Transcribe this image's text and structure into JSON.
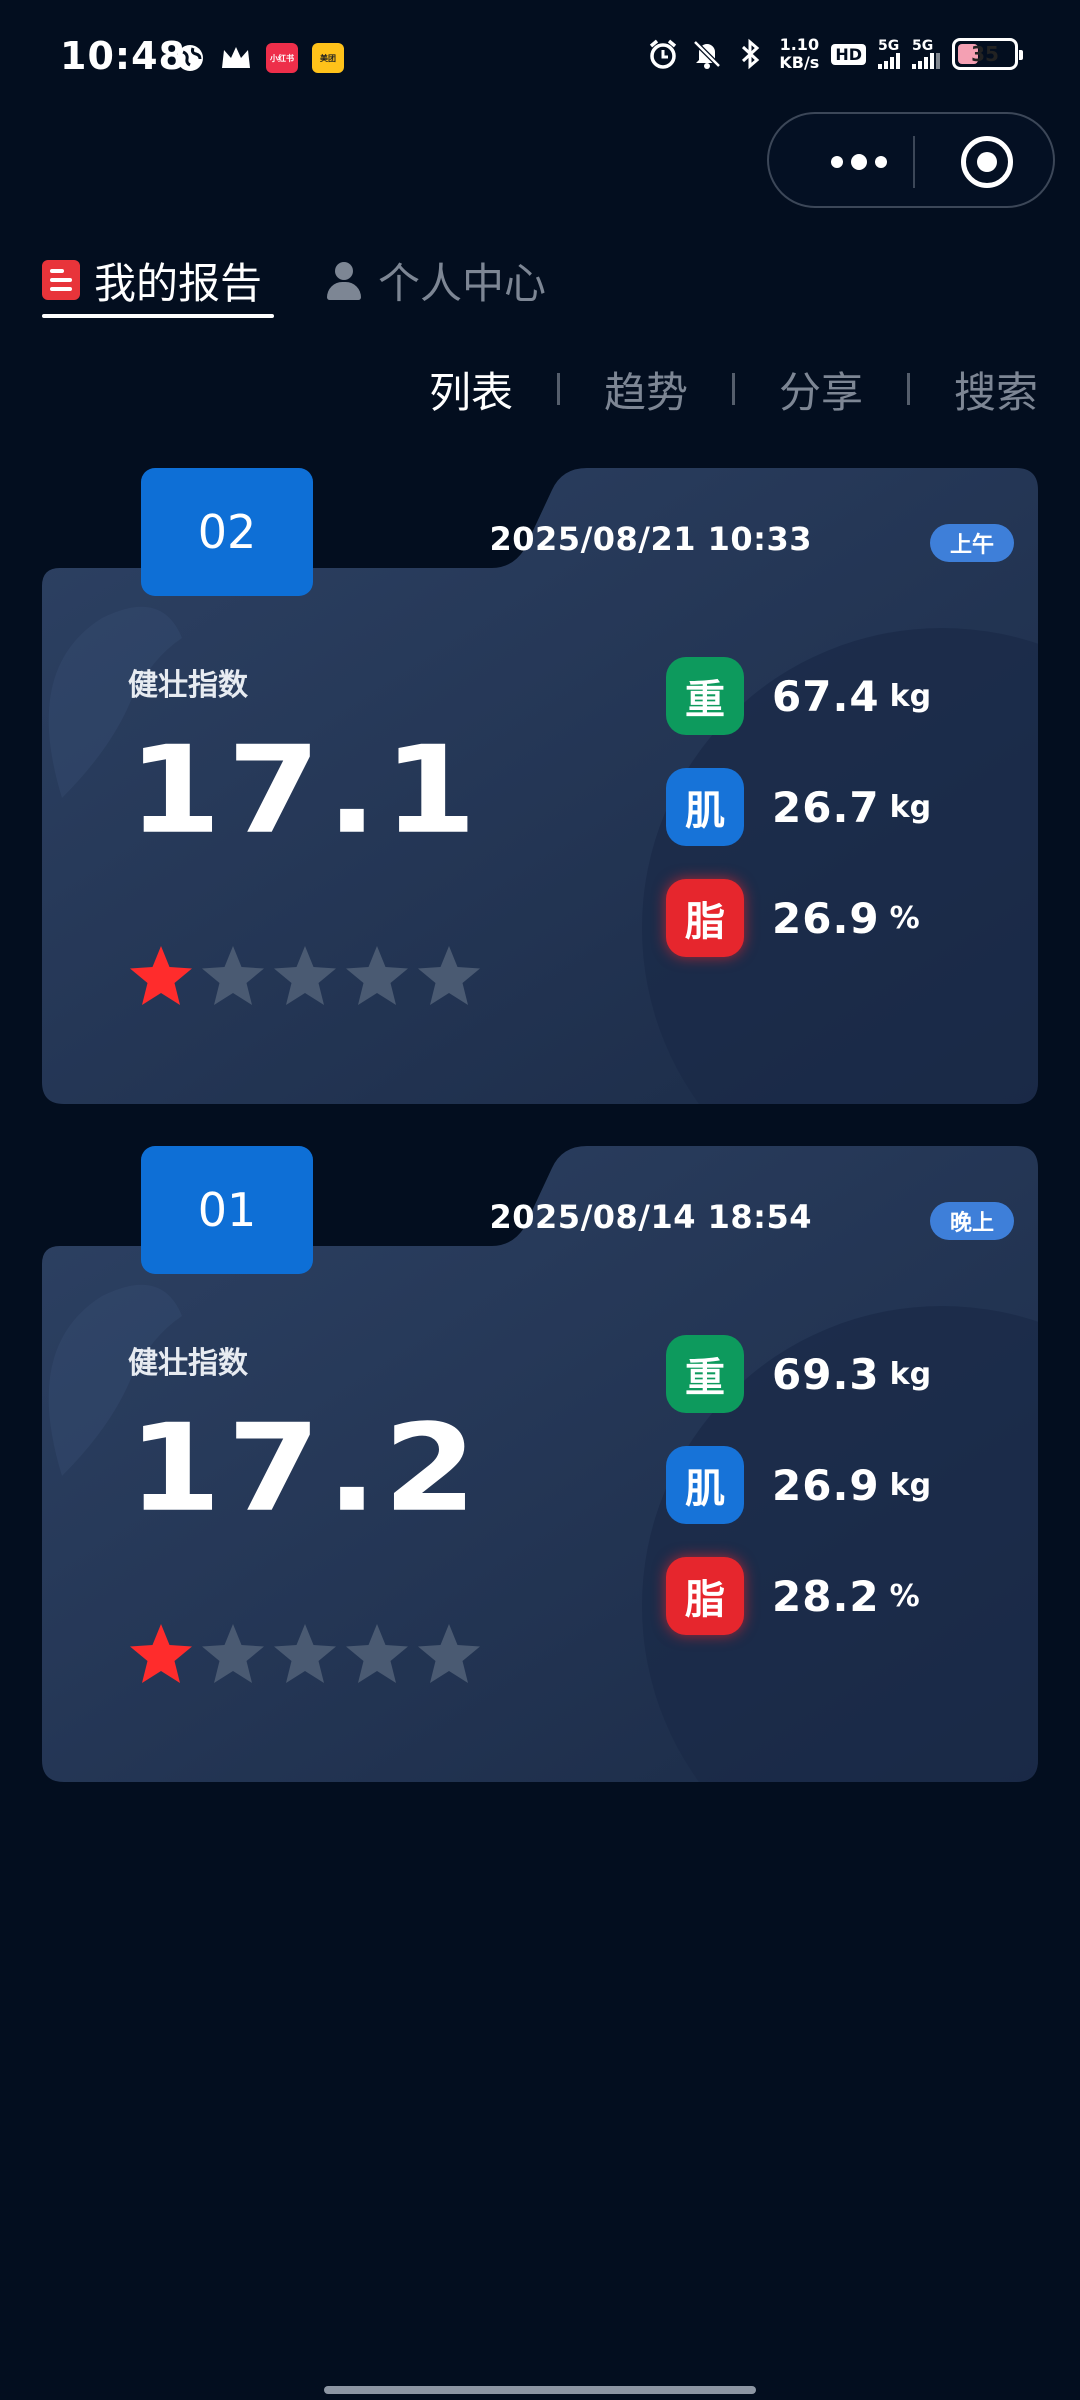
{
  "status_bar": {
    "time": "10:48",
    "app_badges": [
      "小红书",
      "美团"
    ],
    "net_speed_value": "1.10",
    "net_speed_unit": "KB/s",
    "hd_label": "HD",
    "signal_labels": [
      "5G",
      "5G"
    ],
    "battery": "35",
    "icons": [
      "globe-icon",
      "crown-icon",
      "alarm-icon",
      "mute-icon",
      "bluetooth-icon"
    ]
  },
  "capsule": {
    "icons": [
      "more-icon",
      "close-target-icon"
    ]
  },
  "tabs": [
    {
      "label": "我的报告",
      "active": true,
      "icon": "report-icon"
    },
    {
      "label": "个人中心",
      "active": false,
      "icon": "person-icon"
    }
  ],
  "subnav": [
    {
      "label": "列表",
      "active": true
    },
    {
      "label": "趋势",
      "active": false
    },
    {
      "label": "分享",
      "active": false
    },
    {
      "label": "搜索",
      "active": false
    }
  ],
  "colors": {
    "accent_blue": "#0e6fd6",
    "weight": "#0d9a5d",
    "muscle": "#1773d8",
    "fat": "#e6262d",
    "star_active": "#ff2c2c",
    "star_inactive": "#4a5a72"
  },
  "reports": [
    {
      "number": "02",
      "datetime": "2025/08/21  10:33",
      "period": "上午",
      "index_label": "健壮指数",
      "index_value": "17.1",
      "stars": 1,
      "stars_total": 5,
      "metrics": [
        {
          "icon_text": "重",
          "value": "67.4",
          "unit": "kg"
        },
        {
          "icon_text": "肌",
          "value": "26.7",
          "unit": "kg"
        },
        {
          "icon_text": "脂",
          "value": "26.9",
          "unit": "%"
        }
      ]
    },
    {
      "number": "01",
      "datetime": "2025/08/14  18:54",
      "period": "晚上",
      "index_label": "健壮指数",
      "index_value": "17.2",
      "stars": 1,
      "stars_total": 5,
      "metrics": [
        {
          "icon_text": "重",
          "value": "69.3",
          "unit": "kg"
        },
        {
          "icon_text": "肌",
          "value": "26.9",
          "unit": "kg"
        },
        {
          "icon_text": "脂",
          "value": "28.2",
          "unit": "%"
        }
      ]
    }
  ]
}
